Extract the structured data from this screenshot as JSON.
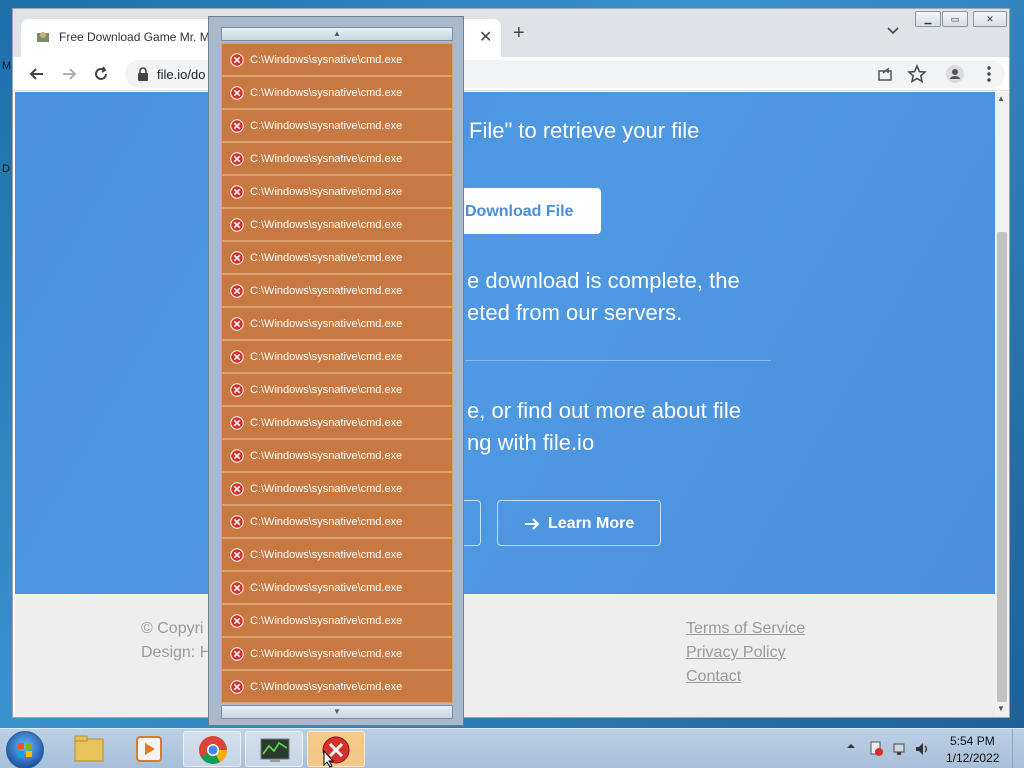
{
  "desktop": {
    "edge_glyphs": [
      "M",
      "D"
    ]
  },
  "browser": {
    "tab": {
      "title": "Free Download Game Mr. M"
    },
    "url": "file.io/do",
    "page": {
      "hero_line1": "File\" to retrieve your file",
      "download_button": "Download File",
      "hero_line2a": "e download is complete, the",
      "hero_line2b": "eted from our servers.",
      "hero_line3a": "e, or find out more about file",
      "hero_line3b": "ng with file.io",
      "learn_more": "Learn More"
    },
    "footer": {
      "copyright": "© Copyri",
      "design": "Design: H",
      "links": [
        "Terms of Service",
        "Privacy Policy",
        "Contact"
      ]
    }
  },
  "error_list": {
    "items": [
      "C:\\Windows\\sysnative\\cmd.exe",
      "C:\\Windows\\sysnative\\cmd.exe",
      "C:\\Windows\\sysnative\\cmd.exe",
      "C:\\Windows\\sysnative\\cmd.exe",
      "C:\\Windows\\sysnative\\cmd.exe",
      "C:\\Windows\\sysnative\\cmd.exe",
      "C:\\Windows\\sysnative\\cmd.exe",
      "C:\\Windows\\sysnative\\cmd.exe",
      "C:\\Windows\\sysnative\\cmd.exe",
      "C:\\Windows\\sysnative\\cmd.exe",
      "C:\\Windows\\sysnative\\cmd.exe",
      "C:\\Windows\\sysnative\\cmd.exe",
      "C:\\Windows\\sysnative\\cmd.exe",
      "C:\\Windows\\sysnative\\cmd.exe",
      "C:\\Windows\\sysnative\\cmd.exe",
      "C:\\Windows\\sysnative\\cmd.exe",
      "C:\\Windows\\sysnative\\cmd.exe",
      "C:\\Windows\\sysnative\\cmd.exe",
      "C:\\Windows\\sysnative\\cmd.exe",
      "C:\\Windows\\sysnative\\cmd.exe"
    ]
  },
  "taskbar": {
    "apps": [
      "explorer-icon",
      "media-player-icon",
      "chrome-icon",
      "task-manager-icon",
      "error-icon"
    ],
    "active_app": "error-icon",
    "time": "5:54 PM",
    "date": "1/12/2022"
  },
  "colors": {
    "hero_blue": "#4a92dd",
    "error_item": "#c87941",
    "popup_frame": "#a7b9cb",
    "footer_bg": "#eeeeee"
  }
}
